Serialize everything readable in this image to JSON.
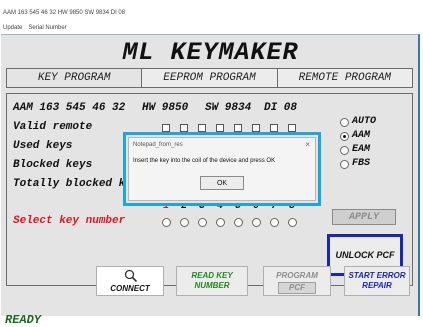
{
  "infobar": {
    "line1": "AAM 163 545 46 32  HW 9850  SW 9834  DI 08",
    "menu": [
      "Update",
      "Serial Number"
    ]
  },
  "title": "ML KEYMAKER",
  "tabs": [
    "KEY PROGRAM",
    "EEPROM PROGRAM",
    "REMOTE PROGRAM"
  ],
  "panel": {
    "id_line": "AAM 163 545 46 32",
    "hw": "HW 9850",
    "sw": "SW 9834",
    "di": "DI 08",
    "labels": {
      "valid": "Valid remote",
      "used": "Used keys",
      "blocked": "Blocked keys",
      "totally": "Totally blocked keys",
      "select": "Select key number"
    },
    "key_numbers": [
      "1",
      "2",
      "3",
      "4",
      "5",
      "6",
      "7",
      "8"
    ],
    "modes": [
      "AUTO",
      "AAM",
      "EAM",
      "FBS"
    ],
    "selected_mode": "AAM",
    "apply_label": "APPLY",
    "unlock_label": "UNLOCK PCF"
  },
  "dialog": {
    "title": "Notepad_from_res",
    "message": "Insert the key into the coil of the device and press OK",
    "ok": "OK",
    "close": "×"
  },
  "status": "READY",
  "buttons": {
    "connect": "CONNECT",
    "read_key_1": "READ KEY",
    "read_key_2": "NUMBER",
    "program": "PROGRAM",
    "pcf": "PCF",
    "start_error_1": "START ERROR",
    "start_error_2": "REPAIR"
  },
  "colors": {
    "red": "#e0141e",
    "blue": "#1727b8",
    "green": "#1e8a1e",
    "dialog_border": "#1ba6de"
  }
}
